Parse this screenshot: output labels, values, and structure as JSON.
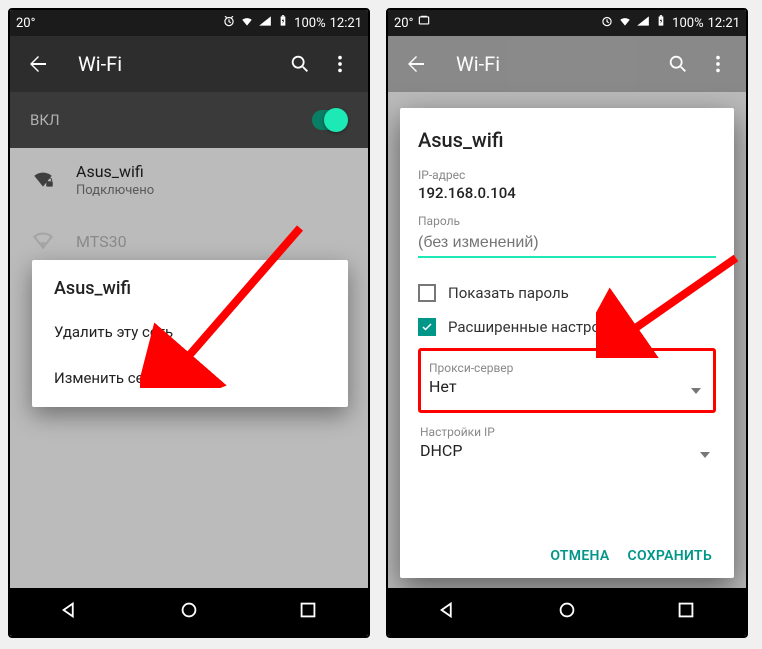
{
  "status": {
    "temp": "20°",
    "battery_pct": "100%",
    "time": "12:21"
  },
  "left": {
    "appbar_title": "Wi-Fi",
    "toggle_label": "ВКЛ",
    "networks": [
      {
        "name": "Asus_wifi",
        "sub": "Подключено",
        "strength": "full-lock"
      },
      {
        "name": "MTS30",
        "sub": "",
        "strength": "weak"
      }
    ],
    "context": {
      "title": "Asus_wifi",
      "item_forget": "Удалить эту сеть",
      "item_modify": "Изменить сеть"
    }
  },
  "right": {
    "appbar_title": "Wi-Fi",
    "dialog": {
      "title": "Asus_wifi",
      "ip_label": "IP-адрес",
      "ip_value": "192.168.0.104",
      "pwd_label": "Пароль",
      "pwd_placeholder": "(без изменений)",
      "show_pwd": "Показать пароль",
      "advanced": "Расширенные настройки",
      "proxy_label": "Прокси-сервер",
      "proxy_value": "Нет",
      "ip_settings_label": "Настройки IP",
      "ip_settings_value": "DHCP",
      "cancel": "ОТМЕНА",
      "save": "СОХРАНИТЬ"
    }
  }
}
